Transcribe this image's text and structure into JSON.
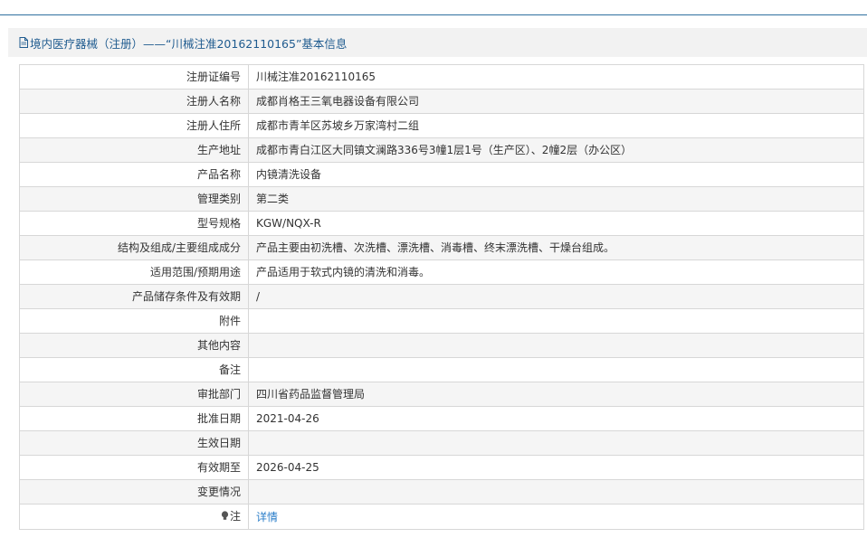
{
  "header": {
    "title": "境内医疗器械（注册）——“川械注准20162110165”基本信息",
    "icon": "document-icon"
  },
  "rows": [
    {
      "label": "注册证编号",
      "value": "川械注准20162110165"
    },
    {
      "label": "注册人名称",
      "value": "成都肖格王三氧电器设备有限公司"
    },
    {
      "label": "注册人住所",
      "value": "成都市青羊区苏坡乡万家湾村二组"
    },
    {
      "label": "生产地址",
      "value": "成都市青白江区大同镇文澜路336号3幢1层1号（生产区）、2幢2层（办公区）"
    },
    {
      "label": "产品名称",
      "value": "内镜清洗设备"
    },
    {
      "label": "管理类别",
      "value": "第二类"
    },
    {
      "label": "型号规格",
      "value": "KGW/NQX-R"
    },
    {
      "label": "结构及组成/主要组成成分",
      "value": "产品主要由初洗槽、次洗槽、漂洗槽、消毒槽、终末漂洗槽、干燥台组成。"
    },
    {
      "label": "适用范围/预期用途",
      "value": "产品适用于软式内镜的清洗和消毒。"
    },
    {
      "label": "产品储存条件及有效期",
      "value": "/"
    },
    {
      "label": "附件",
      "value": ""
    },
    {
      "label": "其他内容",
      "value": ""
    },
    {
      "label": "备注",
      "value": ""
    },
    {
      "label": "审批部门",
      "value": "四川省药品监督管理局"
    },
    {
      "label": "批准日期",
      "value": "2021-04-26"
    },
    {
      "label": "生效日期",
      "value": ""
    },
    {
      "label": "有效期至",
      "value": "2026-04-25"
    },
    {
      "label": "变更情况",
      "value": ""
    }
  ],
  "note": {
    "icon": "lightbulb-icon",
    "label": "注",
    "link_text": "详情"
  },
  "colors": {
    "accent": "#1f5b8f",
    "link": "#2a7dc9",
    "border": "#d7d7d7",
    "stripe": "#f5f5f5",
    "panel_bg": "#f2f2f2"
  }
}
